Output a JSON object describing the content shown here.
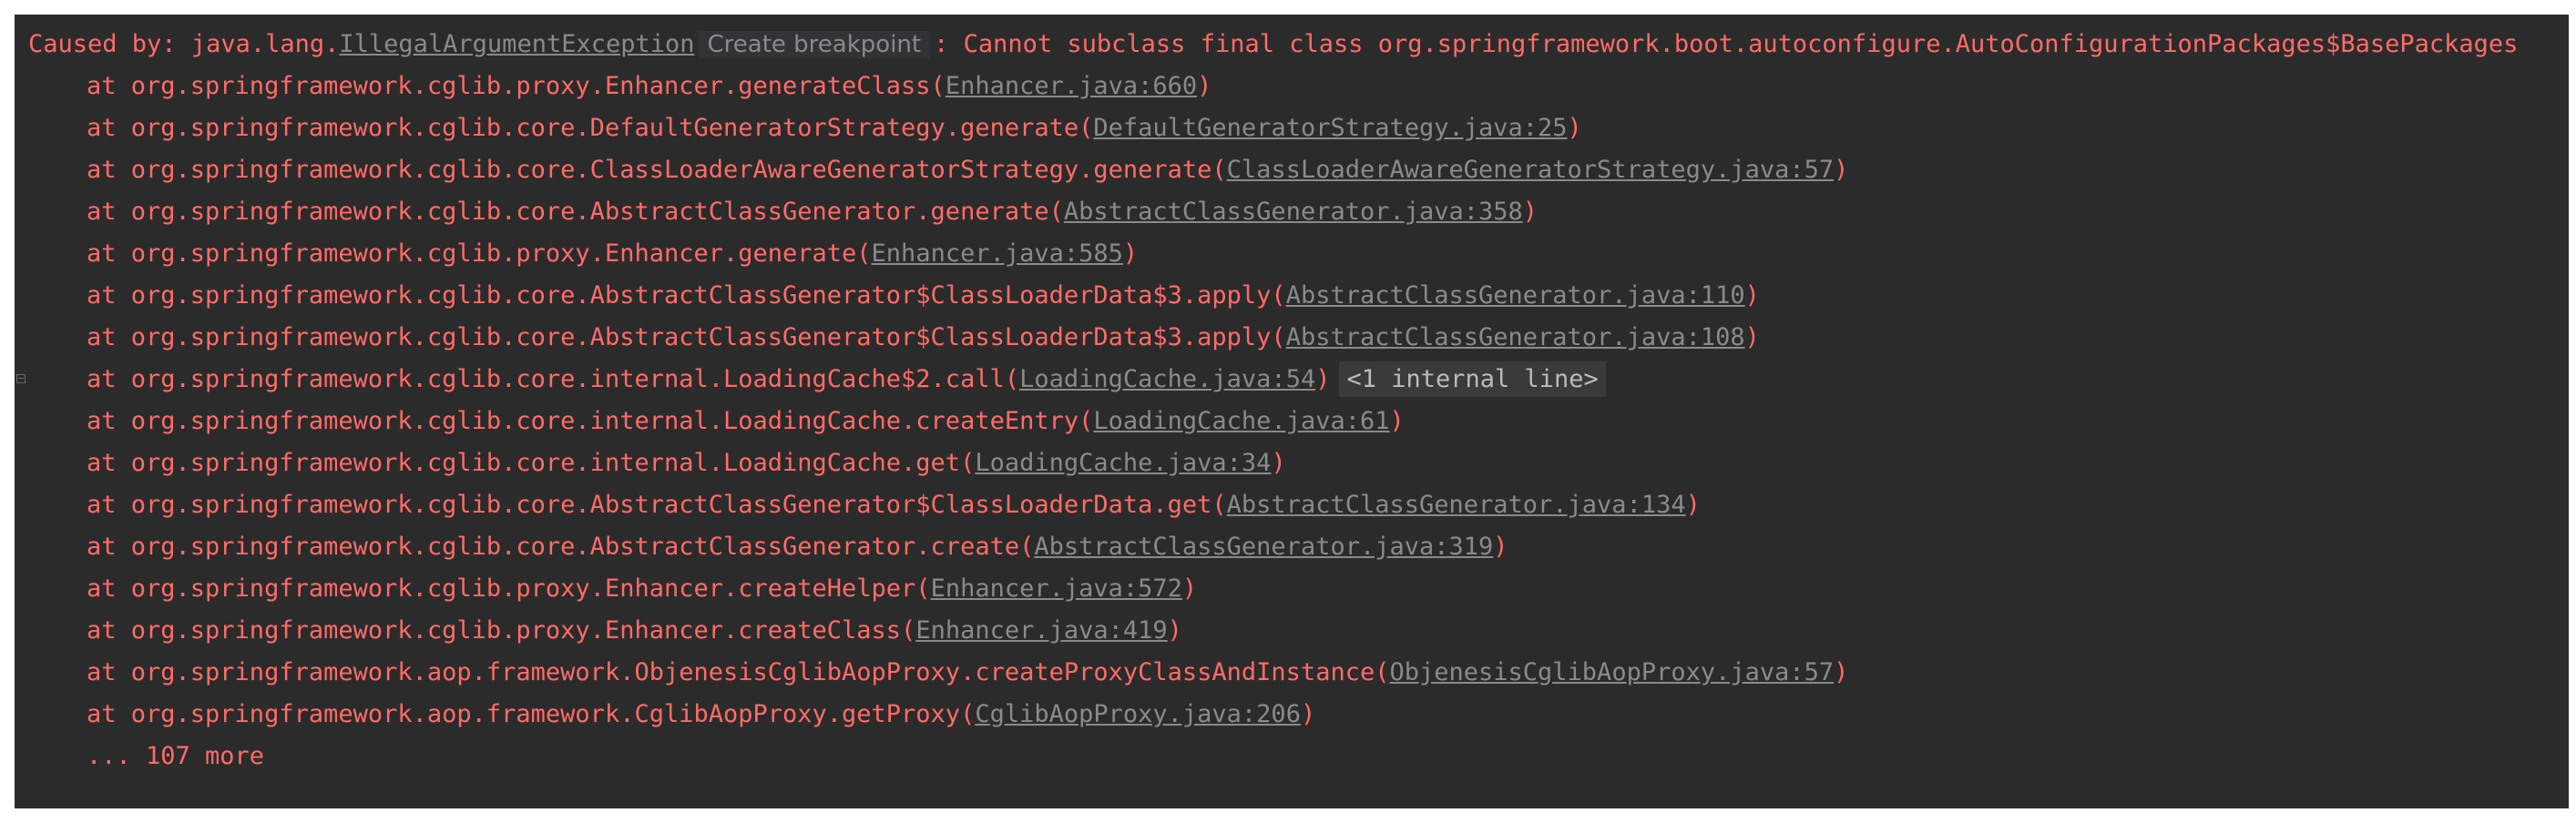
{
  "console": {
    "cause": {
      "prefix": "Caused by: java.lang.",
      "exception_link": "IllegalArgumentException",
      "breakpoint_label": "Create breakpoint",
      "message": ": Cannot subclass final class org.springframework.boot.autoconfigure.AutoConfigurationPackages$BasePackages"
    },
    "frames": [
      {
        "text": "at org.springframework.cglib.proxy.Enhancer.generateClass(",
        "link": "Enhancer.java:660",
        "suffix": ")"
      },
      {
        "text": "at org.springframework.cglib.core.DefaultGeneratorStrategy.generate(",
        "link": "DefaultGeneratorStrategy.java:25",
        "suffix": ")"
      },
      {
        "text": "at org.springframework.cglib.core.ClassLoaderAwareGeneratorStrategy.generate(",
        "link": "ClassLoaderAwareGeneratorStrategy.java:57",
        "suffix": ")"
      },
      {
        "text": "at org.springframework.cglib.core.AbstractClassGenerator.generate(",
        "link": "AbstractClassGenerator.java:358",
        "suffix": ")"
      },
      {
        "text": "at org.springframework.cglib.proxy.Enhancer.generate(",
        "link": "Enhancer.java:585",
        "suffix": ")"
      },
      {
        "text": "at org.springframework.cglib.core.AbstractClassGenerator$ClassLoaderData$3.apply(",
        "link": "AbstractClassGenerator.java:110",
        "suffix": ")"
      },
      {
        "text": "at org.springframework.cglib.core.AbstractClassGenerator$ClassLoaderData$3.apply(",
        "link": "AbstractClassGenerator.java:108",
        "suffix": ")"
      },
      {
        "text": "at org.springframework.cglib.core.internal.LoadingCache$2.call(",
        "link": "LoadingCache.java:54",
        "suffix": ")",
        "internal": "<1 internal line>"
      },
      {
        "text": "at org.springframework.cglib.core.internal.LoadingCache.createEntry(",
        "link": "LoadingCache.java:61",
        "suffix": ")"
      },
      {
        "text": "at org.springframework.cglib.core.internal.LoadingCache.get(",
        "link": "LoadingCache.java:34",
        "suffix": ")"
      },
      {
        "text": "at org.springframework.cglib.core.AbstractClassGenerator$ClassLoaderData.get(",
        "link": "AbstractClassGenerator.java:134",
        "suffix": ")"
      },
      {
        "text": "at org.springframework.cglib.core.AbstractClassGenerator.create(",
        "link": "AbstractClassGenerator.java:319",
        "suffix": ")"
      },
      {
        "text": "at org.springframework.cglib.proxy.Enhancer.createHelper(",
        "link": "Enhancer.java:572",
        "suffix": ")"
      },
      {
        "text": "at org.springframework.cglib.proxy.Enhancer.createClass(",
        "link": "Enhancer.java:419",
        "suffix": ")"
      },
      {
        "text": "at org.springframework.aop.framework.ObjenesisCglibAopProxy.createProxyClassAndInstance(",
        "link": "ObjenesisCglibAopProxy.java:57",
        "suffix": ")"
      },
      {
        "text": "at org.springframework.aop.framework.CglibAopProxy.getProxy(",
        "link": "CglibAopProxy.java:206",
        "suffix": ")"
      }
    ],
    "more": "... 107 more"
  }
}
